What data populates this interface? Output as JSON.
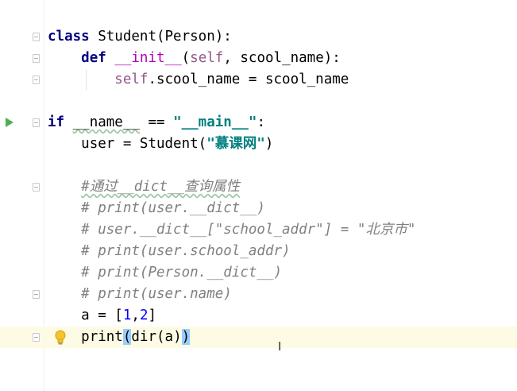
{
  "editor": {
    "colors": {
      "keyword": "#000080",
      "self": "#94558d",
      "magic": "#b200b2",
      "string": "#008080",
      "number": "#0000ff",
      "comment": "#808080",
      "caret_line": "#fdfbe4",
      "brace_match": "#99ccff"
    },
    "icons": {
      "run": "run-arrow-icon",
      "intention": "lightbulb-icon",
      "fold": "fold-marker-icon"
    },
    "code": {
      "l1": {
        "kw": "class",
        "text": " Student(Person):"
      },
      "l2": {
        "indent": "    ",
        "kw": "def",
        "sp": " ",
        "magic": "__init__",
        "open": "(",
        "self": "self",
        "rest": ", scool_name):"
      },
      "l3": {
        "indent": "        ",
        "self": "self",
        "rest": ".scool_name = scool_name"
      },
      "l5": {
        "kw": "if",
        "sp": " ",
        "name": "__name__",
        "eq": " == ",
        "str": "\"__main__\"",
        "colon": ":"
      },
      "l6": {
        "indent": "    ",
        "text": "user = Student(",
        "str": "\"慕课网\"",
        "close": ")"
      },
      "l8": {
        "indent": "    ",
        "comment": "#通过__dict__查询属性"
      },
      "l9": {
        "indent": "    ",
        "comment": "# print(user.__dict__)"
      },
      "l10": {
        "indent": "    ",
        "comment": "# user.__dict__[\"school_addr\"] = \"北京市\""
      },
      "l11": {
        "indent": "    ",
        "comment": "# print(user.school_addr)"
      },
      "l12": {
        "indent": "    ",
        "comment": "# print(Person.__dict__)"
      },
      "l13": {
        "indent": "    ",
        "comment": "# print(user.name)"
      },
      "l14": {
        "indent": "    ",
        "pre": "a = [",
        "n1": "1",
        "comma": ",",
        "n2": "2",
        "post": "]"
      },
      "l15": {
        "indent": "    ",
        "pre": "print",
        "p1": "(",
        "mid": "dir(a)",
        "p2": ")"
      }
    }
  }
}
